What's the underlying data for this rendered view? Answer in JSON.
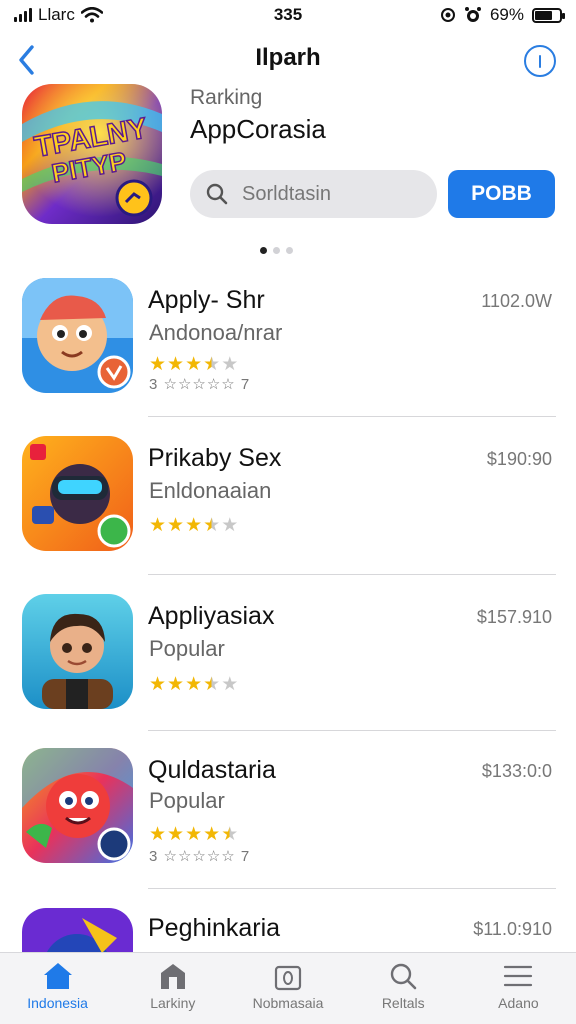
{
  "status_bar": {
    "carrier": "Llarc",
    "time": "335",
    "battery_percent": "69%",
    "battery_level": 0.69
  },
  "nav": {
    "title": "Ilparh"
  },
  "featured": {
    "label": "Rarking",
    "title": "AppCorasia",
    "icon_text_top": "TPALNY",
    "icon_text_bottom": "PITYP",
    "search_placeholder": "Sorldtasin",
    "post_button": "POBB",
    "pages": 3,
    "active_page": 0
  },
  "apps": [
    {
      "name": "Apply- Shr",
      "subtitle": "Andonoa/nrar",
      "price": "1102.0W",
      "rating": 3.5,
      "rating_text": "3 ☆☆☆☆☆ 7",
      "icon": "cartoon-boy-icon"
    },
    {
      "name": "Prikaby Sex",
      "subtitle": "Enldonaaian",
      "price": "$190:90",
      "rating": 3.5,
      "rating_text": "",
      "icon": "vr-headset-icon"
    },
    {
      "name": "Appliyasiax",
      "subtitle": "Popular",
      "price": "$157.910",
      "rating": 3.5,
      "rating_text": "",
      "icon": "boy-portrait-icon"
    },
    {
      "name": "Quldastaria",
      "subtitle": "Popular",
      "price": "$133:0:0",
      "rating": 4.5,
      "rating_text": "3 ☆☆☆☆☆ 7",
      "icon": "red-creature-icon"
    },
    {
      "name": "Peghinkaria",
      "subtitle": "",
      "price": "$11.0:910",
      "rating": 0,
      "rating_text": "",
      "icon": "purple-game-icon"
    }
  ],
  "tabs": [
    {
      "label": "Indonesia",
      "icon": "home-icon",
      "active": true
    },
    {
      "label": "Larkiny",
      "icon": "store-icon",
      "active": false
    },
    {
      "label": "Nobmasaia",
      "icon": "bag-icon",
      "active": false
    },
    {
      "label": "Reltals",
      "icon": "search-icon",
      "active": false
    },
    {
      "label": "Adano",
      "icon": "menu-icon",
      "active": false
    }
  ],
  "colors": {
    "accent": "#1f7ae8",
    "star": "#f2b705",
    "info": "#2a7de1"
  }
}
